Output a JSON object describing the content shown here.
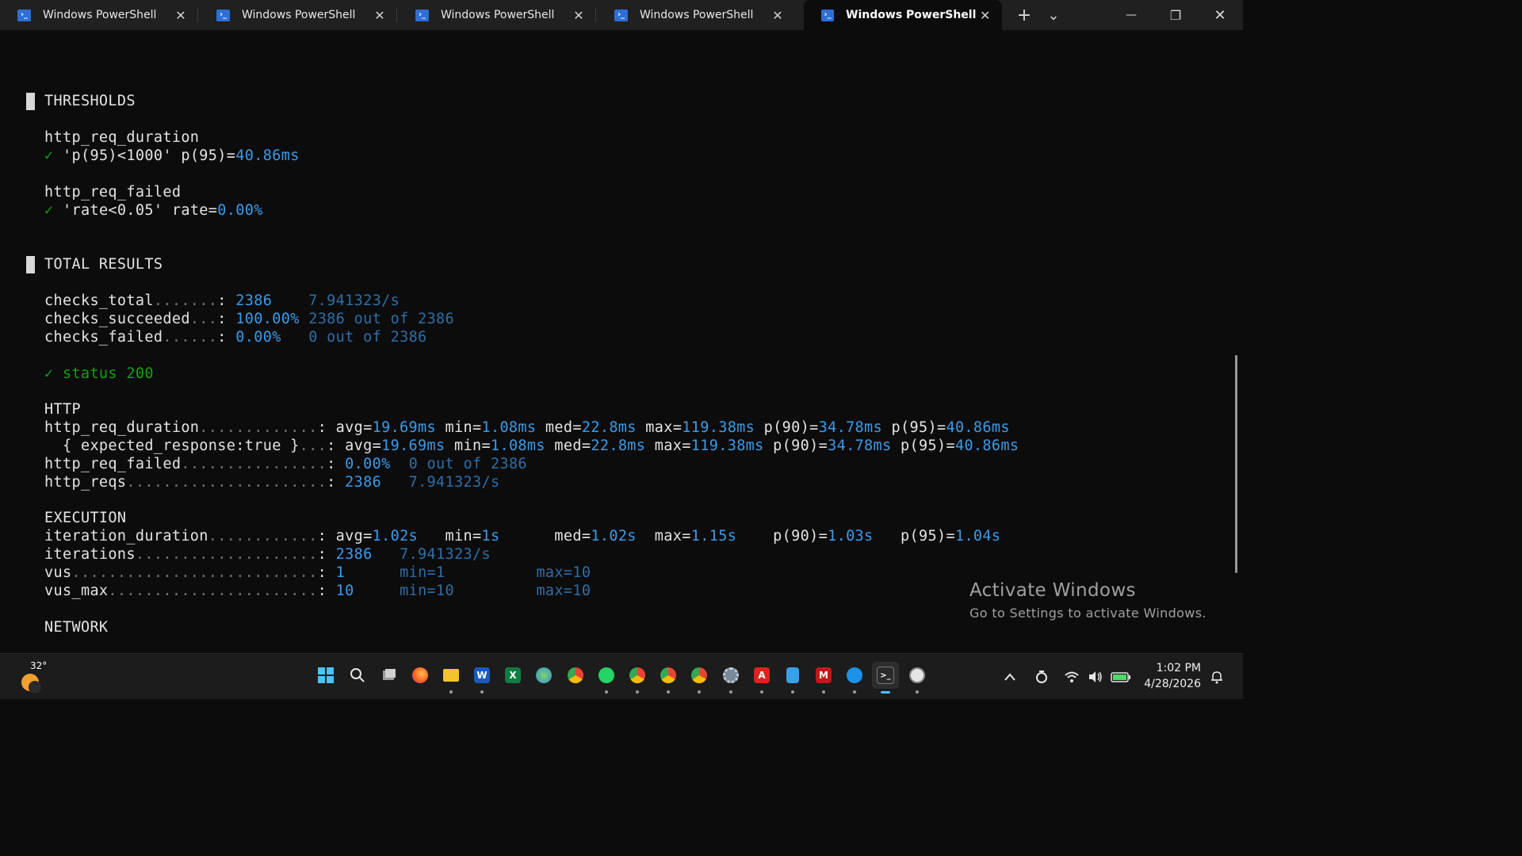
{
  "tabs": [
    {
      "title": "Windows PowerShell",
      "active": false
    },
    {
      "title": "Windows PowerShell",
      "active": false
    },
    {
      "title": "Windows PowerShell",
      "active": false
    },
    {
      "title": "Windows PowerShell",
      "active": false
    },
    {
      "title": "Windows PowerShell",
      "active": true
    }
  ],
  "titlebar": {
    "new_tab": "+",
    "dropdown": "⌄",
    "minimize": "—",
    "restore": "❐",
    "close": "✕",
    "tab_close": "✕",
    "tab_icon": "›_"
  },
  "thresholds": {
    "heading": "THRESHOLDS",
    "duration": {
      "name": "http_req_duration",
      "check": "✓",
      "rule": " 'p(95)<1000' p(95)=",
      "value": "40.86ms"
    },
    "failed": {
      "name": "http_req_failed",
      "check": "✓",
      "rule": " 'rate<0.05' rate=",
      "value": "0.00%"
    }
  },
  "total": {
    "heading": "TOTAL RESULTS",
    "checks": [
      {
        "name": "checks_total",
        "dots": ".......",
        "colon": ":",
        "value": "2386",
        "extra": "7.941323/s"
      },
      {
        "name": "checks_succeeded",
        "dots": "...",
        "colon": ":",
        "value": "100.00%",
        "extra": "2386 out of 2386"
      },
      {
        "name": "checks_failed",
        "dots": "......",
        "colon": ":",
        "value": "0.00%",
        "extra": "0 out of 2386"
      }
    ],
    "status_check": "✓ status 200"
  },
  "http": {
    "heading": "HTTP",
    "req_duration": {
      "name": "http_req_duration",
      "dots": ".............",
      "colon": ":",
      "avg": "19.69ms",
      "min": "1.08ms",
      "med": "22.8ms",
      "max": "119.38ms",
      "p90": "34.78ms",
      "p95": "40.86ms"
    },
    "expected": {
      "name": "  { expected_response:true }",
      "dots": "...",
      "colon": ":",
      "avg": "19.69ms",
      "min": "1.08ms",
      "med": "22.8ms",
      "max": "119.38ms",
      "p90": "34.78ms",
      "p95": "40.86ms"
    },
    "req_failed": {
      "name": "http_req_failed",
      "dots": "................",
      "colon": ":",
      "value": "0.00%",
      "extra": "0 out of 2386"
    },
    "reqs": {
      "name": "http_reqs",
      "dots": "......................",
      "colon": ":",
      "value": "2386",
      "extra": "7.941323/s"
    }
  },
  "execution": {
    "heading": "EXECUTION",
    "iteration_duration": {
      "name": "iteration_duration",
      "dots": "............",
      "colon": ":",
      "avg": "1.02s",
      "min": "1s",
      "med": "1.02s",
      "max": "1.15s",
      "p90": "1.03s",
      "p95": "1.04s"
    },
    "iterations": {
      "name": "iterations",
      "dots": "....................",
      "colon": ":",
      "value": "2386",
      "extra": "7.941323/s"
    },
    "vus": {
      "name": "vus",
      "dots": "...........................",
      "colon": ":",
      "value": "1",
      "min": "min=1",
      "max": "max=10"
    },
    "vus_max": {
      "name": "vus_max",
      "dots": ".......................",
      "colon": ":",
      "value": "10",
      "min": "min=10",
      "max": "max=10"
    }
  },
  "network": {
    "heading": "NETWORK"
  },
  "labels": {
    "avg": "avg=",
    "min": "min=",
    "med": "med=",
    "max": "max=",
    "p90": "p(90)=",
    "p95": "p(95)="
  },
  "watermark": {
    "title": "Activate Windows",
    "subtitle": "Go to Settings to activate Windows."
  },
  "taskbar": {
    "weather_temp": "32°",
    "time": "1:02 PM",
    "date": "4/28/2026",
    "apps": [
      "start-icon",
      "search-icon",
      "task-view-icon",
      "firefox-icon",
      "file-explorer-icon",
      "word-icon",
      "excel-icon",
      "globe-icon",
      "chrome-icon",
      "whatsapp-icon",
      "chrome-profile-icon",
      "chrome-profile-2-icon",
      "chrome-profile-3-icon",
      "settings-icon",
      "acrobat-icon",
      "notepad-icon",
      "mcafee-icon",
      "docker-icon",
      "terminal-icon",
      "clock-app-icon"
    ]
  },
  "colors": {
    "accent": "#3b9be8",
    "dim": "#2e6ea8",
    "pass": "#13a10e",
    "bg": "#0c0c0c"
  }
}
